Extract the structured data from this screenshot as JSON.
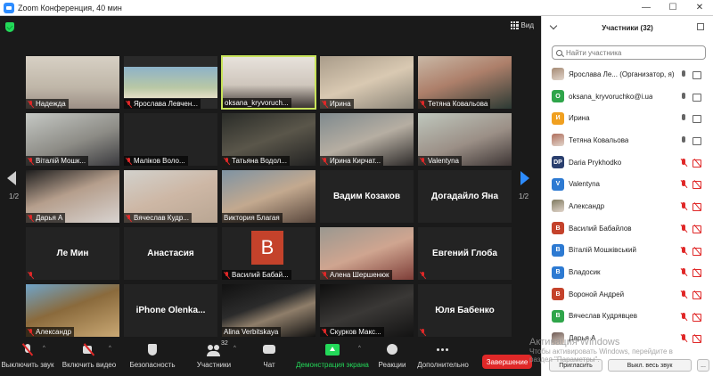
{
  "window": {
    "title": "Zoom Конференция, 40 мин",
    "min": "—",
    "max": "☐",
    "close": "✕"
  },
  "view_button": {
    "label": "Вид"
  },
  "pager": {
    "left": "1/2",
    "right": "1/2"
  },
  "tiles": [
    {
      "name": "Надежда",
      "muted": true,
      "video": true,
      "bg": "linear-gradient(180deg,#d7d0c4 0%,#bfb6a8 60%,#9c8f86 100%)"
    },
    {
      "name": "Ярослава Левчен...",
      "muted": true,
      "video": true,
      "bg": "linear-gradient(180deg,#2a2a2a 0%,#2a2a2a 20%,#8db2c9 20%,#b9c8a5 60%,#e5e0c8 80%,#2a2a2a 80%)"
    },
    {
      "name": "oksana_kryvoruch...",
      "muted": false,
      "video": true,
      "active": true,
      "bg": "linear-gradient(180deg,#e7e2dc 0%,#cfc6bc 55%,#3a3330 100%)"
    },
    {
      "name": "Ирина",
      "muted": true,
      "video": true,
      "bg": "linear-gradient(160deg,#a99c8a 0%,#d9c9b2 50%,#8a8478 100%)"
    },
    {
      "name": "Тетяна Ковальова",
      "muted": true,
      "video": true,
      "bg": "linear-gradient(160deg,#c9b8a6 0%,#ad7f6a 45%,#2c3a34 100%)"
    },
    {
      "name": "Віталій Мошк...",
      "muted": true,
      "video": true,
      "bg": "linear-gradient(160deg,#c5c8c4 0%,#8d8c86 55%,#3a3a3e 100%)"
    },
    {
      "name": "Маліков Воло...",
      "muted": true,
      "video": false,
      "bg": ""
    },
    {
      "name": "Татьяна Водол...",
      "muted": true,
      "video": true,
      "bg": "linear-gradient(160deg,#2a2c28 0%,#5a564a 50%,#222 100%)"
    },
    {
      "name": "Ирина Кирчат...",
      "muted": true,
      "video": true,
      "bg": "linear-gradient(160deg,#7f8a8e 0%,#b6aea2 50%,#2e2b2a 100%)"
    },
    {
      "name": "Valentyna",
      "muted": true,
      "video": true,
      "bg": "linear-gradient(160deg,#bfc7bd 0%,#9b8f86 55%,#3d3534 100%)"
    },
    {
      "name": "Дарья А",
      "muted": true,
      "video": true,
      "bg": "linear-gradient(160deg,#1e1e1e 0%,#b59e8c 45%,#d8d3d0 100%)"
    },
    {
      "name": "Вячеслав Кудр...",
      "muted": true,
      "video": true,
      "bg": "linear-gradient(160deg,#d2d1cc 0%,#cdb7a5 50%,#b9a693 100%)"
    },
    {
      "name": "Виктория Благая",
      "muted": false,
      "video": true,
      "bg": "linear-gradient(160deg,#7e93a3 0%,#c3a98f 50%,#58463c 100%)"
    },
    {
      "name": "Вадим Козаков",
      "muted": false,
      "video": false,
      "bigname": true
    },
    {
      "name": "Догадайло Яна",
      "muted": false,
      "video": false,
      "bigname": true
    },
    {
      "name": "Ле Мин",
      "muted": true,
      "video": false,
      "bigname": true
    },
    {
      "name": "Анастасия",
      "muted": false,
      "video": false,
      "bigname": true
    },
    {
      "name": "Василий Бабай...",
      "muted": true,
      "video": false,
      "avatar": "B"
    },
    {
      "name": "Алена Шершенюк",
      "muted": true,
      "video": true,
      "bg": "linear-gradient(160deg,#9a9890 0%,#cfa590 50%,#7e3e38 100%)"
    },
    {
      "name": "Евгений Глоба",
      "muted": true,
      "video": false,
      "bigname": true
    },
    {
      "name": "Александр",
      "muted": true,
      "video": true,
      "bg": "linear-gradient(160deg,#6fa4c9 0%,#8a6a3c 45%,#c9a874 100%)"
    },
    {
      "name": "iPhone  Olenka...",
      "muted": false,
      "video": false,
      "bigname": true
    },
    {
      "name": "Alina Verbitskaya",
      "muted": false,
      "video": true,
      "bg": "linear-gradient(160deg,#111 0%,#2b2b2b 40%,#8f7e6a 60%,#111 100%)"
    },
    {
      "name": "Скурков Макс...",
      "muted": true,
      "video": true,
      "bg": "linear-gradient(160deg,#0e0e0e 0%,#3a3836 50%,#131313 100%)"
    },
    {
      "name": "Юля Бабенко",
      "muted": true,
      "video": false,
      "bigname": true
    }
  ],
  "toolbar": {
    "mic": "Выключить звук",
    "video": "Включить видео",
    "security": "Безопасность",
    "participants": "Участники",
    "participants_count": "32",
    "chat": "Чат",
    "share": "Демонстрация экрана",
    "reactions": "Реакции",
    "more": "Дополнительно",
    "end": "Завершение"
  },
  "panel": {
    "title": "Участники (32)",
    "search_placeholder": "Найти участника",
    "participants": [
      {
        "name": "Ярослава Ле... (Организатор, я)",
        "initial": "",
        "color": "#a58a74",
        "photo": true,
        "mic_muted": false,
        "cam_off": false
      },
      {
        "name": "oksana_kryvoruchko@i.ua",
        "initial": "O",
        "color": "#2fa54a",
        "mic_muted": false,
        "cam_off": false
      },
      {
        "name": "Ирина",
        "initial": "И",
        "color": "#f0a020",
        "mic_muted": false,
        "cam_off": false
      },
      {
        "name": "Тетяна Ковальова",
        "initial": "",
        "color": "#b06f5d",
        "photo": true,
        "mic_muted": false,
        "cam_off": false
      },
      {
        "name": "Daria Prykhodko",
        "initial": "DP",
        "color": "#2a3f6e",
        "mic_muted": true,
        "cam_off": true
      },
      {
        "name": "Valentyna",
        "initial": "V",
        "color": "#2d7ad2",
        "mic_muted": true,
        "cam_off": true
      },
      {
        "name": "Александр",
        "initial": "",
        "color": "#7f7a60",
        "photo": true,
        "mic_muted": true,
        "cam_off": true
      },
      {
        "name": "Василий Бабайлов",
        "initial": "B",
        "color": "#c4422b",
        "mic_muted": true,
        "cam_off": true
      },
      {
        "name": "Віталій Мошківський",
        "initial": "B",
        "color": "#2d7ad2",
        "mic_muted": true,
        "cam_off": true
      },
      {
        "name": "Владосик",
        "initial": "B",
        "color": "#2d7ad2",
        "mic_muted": true,
        "cam_off": true
      },
      {
        "name": "Вороной Андрей",
        "initial": "B",
        "color": "#c4422b",
        "mic_muted": true,
        "cam_off": true
      },
      {
        "name": "Вячеслав Кудрявцев",
        "initial": "B",
        "color": "#2fa54a",
        "mic_muted": true,
        "cam_off": true
      },
      {
        "name": "Дарья А",
        "initial": "",
        "color": "#6e5a54",
        "photo": true,
        "mic_muted": true,
        "cam_off": true
      }
    ],
    "invite": "Пригласить",
    "mute_all": "Выкл. весь звук",
    "more": "..."
  },
  "watermark": {
    "line1": "Активация Windows",
    "line2": "Чтобы активировать Windows, перейдите в",
    "line3": "раздел \"Параметры\"."
  }
}
